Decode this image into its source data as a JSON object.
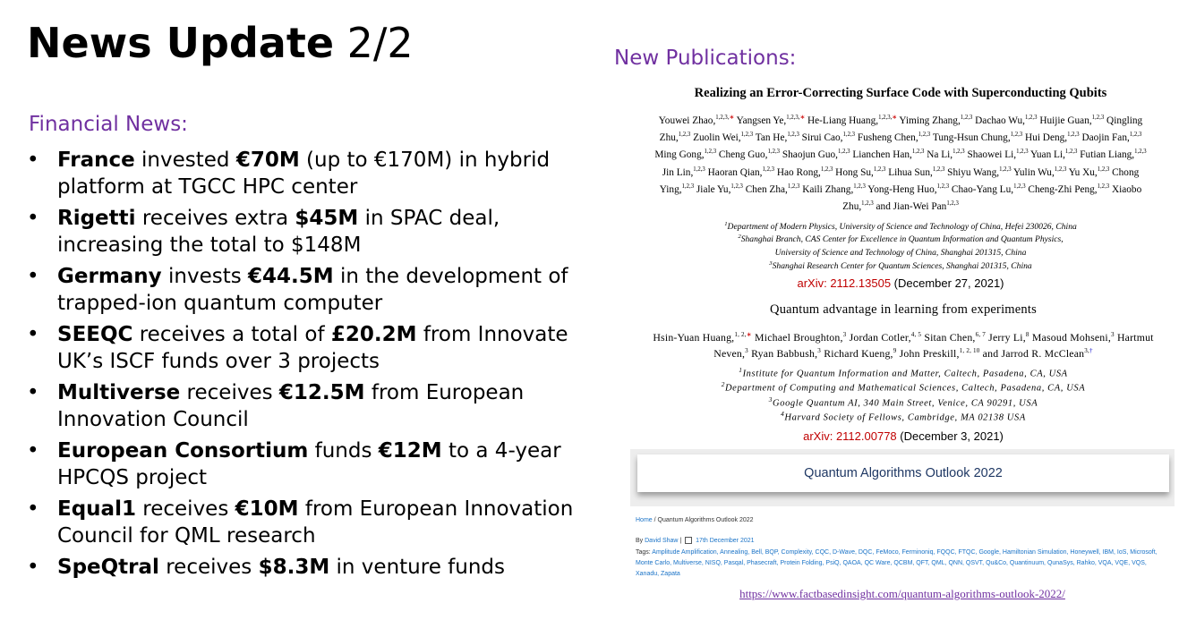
{
  "title": {
    "bold": "News Update",
    "rest": "2/2"
  },
  "financial": {
    "heading": "Financial News:",
    "items": [
      {
        "parts": [
          {
            "t": "France",
            "b": true
          },
          {
            "t": " invested "
          },
          {
            "t": "€70M",
            "b": true
          },
          {
            "t": " (up to €170M) in hybrid platform at TGCC HPC center"
          }
        ]
      },
      {
        "parts": [
          {
            "t": "Rigetti",
            "b": true
          },
          {
            "t": " receives extra "
          },
          {
            "t": "$45M",
            "b": true
          },
          {
            "t": " in SPAC deal, increasing the total to $148M"
          }
        ]
      },
      {
        "parts": [
          {
            "t": "Germany",
            "b": true
          },
          {
            "t": " invests "
          },
          {
            "t": "€44.5M",
            "b": true
          },
          {
            "t": " in the development of trapped-ion quantum computer"
          }
        ]
      },
      {
        "parts": [
          {
            "t": "SEEQC",
            "b": true
          },
          {
            "t": " receives a total of "
          },
          {
            "t": "£20.2M",
            "b": true
          },
          {
            "t": " from Innovate UK’s ISCF funds over 3 projects"
          }
        ]
      },
      {
        "parts": [
          {
            "t": "Multiverse",
            "b": true
          },
          {
            "t": " receives "
          },
          {
            "t": "€12.5M",
            "b": true
          },
          {
            "t": " from European Innovation Council"
          }
        ]
      },
      {
        "parts": [
          {
            "t": "European Consortium",
            "b": true
          },
          {
            "t": " funds "
          },
          {
            "t": "€12M",
            "b": true
          },
          {
            "t": " to a 4-year HPCQS project"
          }
        ]
      },
      {
        "parts": [
          {
            "t": "Equal1",
            "b": true
          },
          {
            "t": " receives "
          },
          {
            "t": "€10M",
            "b": true
          },
          {
            "t": " from European Innovation Council for QML research"
          }
        ]
      },
      {
        "parts": [
          {
            "t": "SpeQtral",
            "b": true
          },
          {
            "t": " receives "
          },
          {
            "t": "$8.3M",
            "b": true
          },
          {
            "t": " in venture funds"
          }
        ]
      }
    ]
  },
  "publications": {
    "heading": "New Publications:",
    "paper1": {
      "title": "Realizing an Error-Correcting Surface Code with Superconducting Qubits",
      "authors": [
        {
          "n": "Youwei Zhao,",
          "s": "1,2,3,",
          "star": true
        },
        {
          "n": "Yangsen Ye,",
          "s": "1,2,3,",
          "star": true
        },
        {
          "n": "He-Liang Huang,",
          "s": "1,2,3,",
          "star": true
        },
        {
          "n": "Yiming Zhang,",
          "s": "1,2,3"
        },
        {
          "n": "Dachao Wu,",
          "s": "1,2,3"
        },
        {
          "n": "Huijie Guan,",
          "s": "1,2,3"
        },
        {
          "n": "Qingling Zhu,",
          "s": "1,2,3"
        },
        {
          "n": "Zuolin Wei,",
          "s": "1,2,3"
        },
        {
          "n": "Tan He,",
          "s": "1,2,3"
        },
        {
          "n": "Sirui Cao,",
          "s": "1,2,3"
        },
        {
          "n": "Fusheng Chen,",
          "s": "1,2,3"
        },
        {
          "n": "Tung-Hsun Chung,",
          "s": "1,2,3"
        },
        {
          "n": "Hui Deng,",
          "s": "1,2,3"
        },
        {
          "n": "Daojin Fan,",
          "s": "1,2,3"
        },
        {
          "n": "Ming Gong,",
          "s": "1,2,3"
        },
        {
          "n": "Cheng Guo,",
          "s": "1,2,3"
        },
        {
          "n": "Shaojun Guo,",
          "s": "1,2,3"
        },
        {
          "n": "Lianchen Han,",
          "s": "1,2,3"
        },
        {
          "n": "Na Li,",
          "s": "1,2,3"
        },
        {
          "n": "Shaowei Li,",
          "s": "1,2,3"
        },
        {
          "n": "Yuan Li,",
          "s": "1,2,3"
        },
        {
          "n": "Futian Liang,",
          "s": "1,2,3"
        },
        {
          "n": "Jin Lin,",
          "s": "1,2,3"
        },
        {
          "n": "Haoran Qian,",
          "s": "1,2,3"
        },
        {
          "n": "Hao Rong,",
          "s": "1,2,3"
        },
        {
          "n": "Hong Su,",
          "s": "1,2,3"
        },
        {
          "n": "Lihua Sun,",
          "s": "1,2,3"
        },
        {
          "n": "Shiyu Wang,",
          "s": "1,2,3"
        },
        {
          "n": "Yulin Wu,",
          "s": "1,2,3"
        },
        {
          "n": "Yu Xu,",
          "s": "1,2,3"
        },
        {
          "n": "Chong Ying,",
          "s": "1,2,3"
        },
        {
          "n": "Jiale Yu,",
          "s": "1,2,3"
        },
        {
          "n": "Chen Zha,",
          "s": "1,2,3"
        },
        {
          "n": "Kaili Zhang,",
          "s": "1,2,3"
        },
        {
          "n": "Yong-Heng Huo,",
          "s": "1,2,3"
        },
        {
          "n": "Chao-Yang Lu,",
          "s": "1,2,3"
        },
        {
          "n": "Cheng-Zhi Peng,",
          "s": "1,2,3"
        },
        {
          "n": "Xiaobo Zhu,",
          "s": "1,2,3"
        },
        {
          "n": "and Jian-Wei Pan",
          "s": "1,2,3"
        }
      ],
      "affiliations": [
        {
          "s": "1",
          "t": "Department of Modern Physics, University of Science and Technology of China, Hefei 230026, China"
        },
        {
          "s": "2",
          "t": "Shanghai Branch, CAS Center for Excellence in Quantum Information and Quantum Physics,"
        },
        {
          "s": "",
          "t": "University of Science and Technology of China, Shanghai 201315, China"
        },
        {
          "s": "3",
          "t": "Shanghai Research Center for Quantum Sciences, Shanghai 201315, China"
        }
      ],
      "arxiv_prefix": "arXiv: ",
      "arxiv_id": "2112.13505",
      "date": " (December 27, 2021)"
    },
    "paper2": {
      "title": "Quantum advantage in learning from experiments",
      "authors": [
        {
          "n": "Hsin-Yuan Huang,",
          "s": "1, 2,",
          "star": true
        },
        {
          "n": "Michael Broughton,",
          "s": "3"
        },
        {
          "n": "Jordan Cotler,",
          "s": "4, 5"
        },
        {
          "n": "Sitan Chen,",
          "s": "6, 7"
        },
        {
          "n": "Jerry Li,",
          "s": "8"
        },
        {
          "n": "Masoud Mohseni,",
          "s": "3"
        },
        {
          "n": "Hartmut Neven,",
          "s": "3"
        },
        {
          "n": "Ryan Babbush,",
          "s": "3"
        },
        {
          "n": "Richard Kueng,",
          "s": "9"
        },
        {
          "n": "John Preskill,",
          "s": "1, 2, 10"
        },
        {
          "n": "and Jarrod R. McClean",
          "s": "3,",
          "dagger": true
        }
      ],
      "affiliations": [
        {
          "s": "1",
          "t": "Institute for Quantum Information and Matter, Caltech, Pasadena, CA, USA"
        },
        {
          "s": "2",
          "t": "Department of Computing and Mathematical Sciences, Caltech, Pasadena, CA, USA"
        },
        {
          "s": "3",
          "t": "Google Quantum AI, 340 Main Street, Venice, CA 90291, USA"
        },
        {
          "s": "4",
          "t": "Harvard Society of Fellows, Cambridge, MA 02138 USA"
        }
      ],
      "arxiv_prefix": "arXiv: ",
      "arxiv_id": "2112.00778",
      "date": " (December 3, 2021)"
    },
    "website": {
      "banner": "Quantum Algorithms Outlook 2022",
      "crumb_home": "Home",
      "crumb_sep": " / ",
      "crumb_page": "Quantum Algorithms Outlook 2022",
      "by": "By ",
      "author": "David Shaw",
      "sep": " | ",
      "date": "17th December 2021",
      "tags_label": "Tags: ",
      "tags": "Amplitude Amplification, Annealing, Bell, BQP, Complexity, CQC, D-Wave, DQC, FeMoco, Ferminoniq, FQQC, FTQC, Google, Hamiltonian Simulation, Honeywell, IBM, IoS, Microsoft, Monte Carlo, Multiverse, NISQ, Pasqal, Phasecraft, Protein Folding, PsiQ, QAOA, QC Ware, QCBM, QFT, QML, QNN, QSVT, Qu&Co, Quantinuum, QunaSys, Rahko, VQA, VQE, VQS, Xanadu, Zapata",
      "url": "https://www.factbasedinsight.com/quantum-algorithms-outlook-2022/"
    }
  }
}
